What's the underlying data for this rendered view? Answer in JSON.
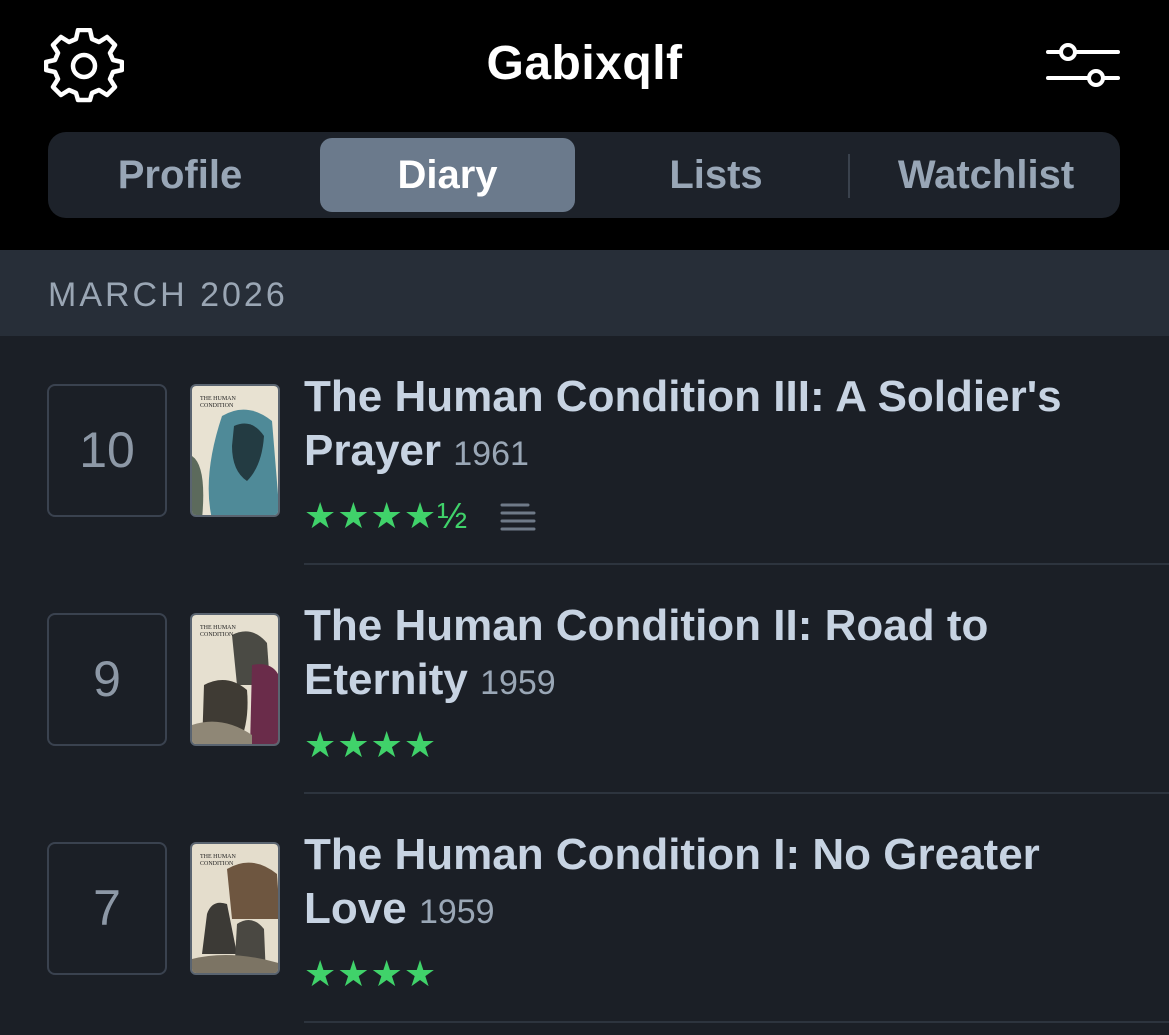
{
  "header": {
    "title": "Gabixqlf",
    "settings_icon": "gear-icon",
    "filter_icon": "sliders-icon"
  },
  "tabs": [
    {
      "label": "Profile",
      "active": false
    },
    {
      "label": "Diary",
      "active": true
    },
    {
      "label": "Lists",
      "active": false
    },
    {
      "label": "Watchlist",
      "active": false
    }
  ],
  "diary": {
    "month": "MARCH 2026",
    "entries": [
      {
        "day": "10",
        "title": "The Human Condition III: A Soldier's Prayer",
        "year": "1961",
        "rating_stars": "★★★★½",
        "rating": 4.5,
        "has_review": true,
        "poster_text": "THE HUMAN CONDITION"
      },
      {
        "day": "9",
        "title": "The Human Condition II: Road to Eternity",
        "year": "1959",
        "rating_stars": "★★★★",
        "rating": 4,
        "has_review": false,
        "poster_text": "THE HUMAN CONDITION"
      },
      {
        "day": "7",
        "title": "The Human Condition I: No Greater Love",
        "year": "1959",
        "rating_stars": "★★★★",
        "rating": 4,
        "has_review": false,
        "poster_text": "THE HUMAN CONDITION"
      }
    ]
  },
  "colors": {
    "header_bg": "#000000",
    "active_tab": "#6b7a8c",
    "star_green": "#40d26a",
    "title_text": "#c7d3e2"
  }
}
